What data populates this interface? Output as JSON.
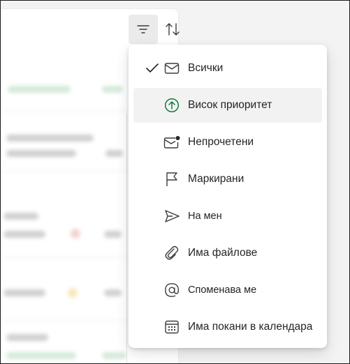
{
  "toolbar": {
    "filter_icon": "filter-icon",
    "sort_icon": "sort-icon"
  },
  "filter_menu": {
    "selected": "Всички",
    "items": [
      {
        "label": "Всички",
        "icon": "mail-icon",
        "checked": true
      },
      {
        "label": "Висок приоритет",
        "icon": "arrow-up-circle-icon",
        "hovered": true
      },
      {
        "label": "Непрочетени",
        "icon": "mail-unread-icon"
      },
      {
        "label": "Маркирани",
        "icon": "flag-icon"
      },
      {
        "label": "На мен",
        "icon": "send-icon"
      },
      {
        "label": "Има файлове",
        "icon": "attach-icon"
      },
      {
        "label": "Споменава ме",
        "icon": "at-sign-icon"
      },
      {
        "label": "Има покани в календара",
        "icon": "calendar-icon"
      }
    ]
  },
  "colors": {
    "accent_green": "#107c41",
    "menu_bg": "#ffffff",
    "hover_bg": "#f2f2f2",
    "text": "#242424"
  }
}
